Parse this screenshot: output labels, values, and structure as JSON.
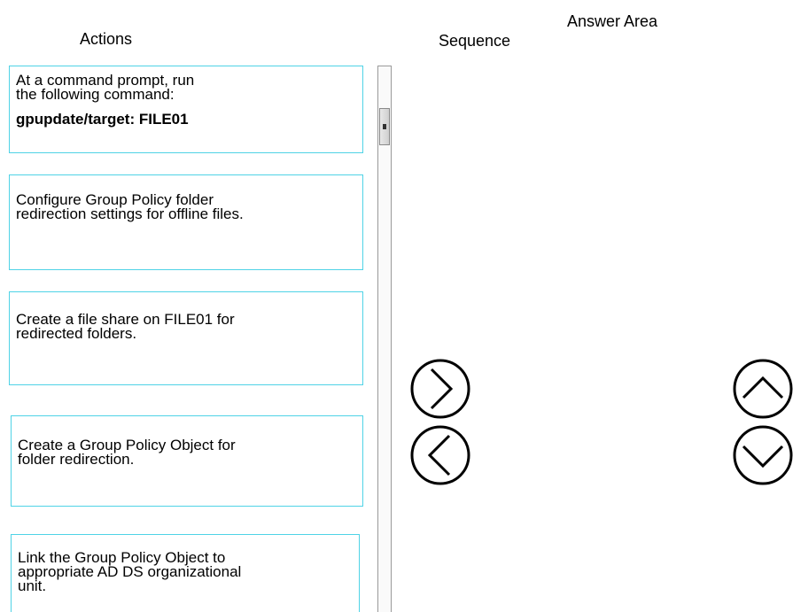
{
  "headers": {
    "actions": "Actions",
    "answer_area": "Answer Area",
    "sequence": "Sequence"
  },
  "actions": [
    {
      "lines": [
        "At a command prompt, run",
        "the following command:"
      ],
      "bold": "gpupdate/target: FILE01"
    },
    {
      "lines": [
        "Configure Group Policy folder",
        "redirection settings for offline files."
      ]
    },
    {
      "lines": [
        "Create a file share on FILE01 for",
        "redirected folders."
      ]
    },
    {
      "lines": [
        "Create a Group Policy Object for",
        "folder redirection."
      ]
    },
    {
      "lines": [
        "Link the Group Policy Object to",
        "appropriate AD DS organizational",
        "unit."
      ]
    }
  ],
  "sequence": [],
  "controls": {
    "move_right_icon": "chevron-right-circle-icon",
    "move_left_icon": "chevron-left-circle-icon",
    "move_up_icon": "chevron-up-circle-icon",
    "move_down_icon": "chevron-down-circle-icon"
  },
  "colors": {
    "card_border": "#4fd3e6",
    "text": "#000000",
    "background": "#ffffff"
  }
}
